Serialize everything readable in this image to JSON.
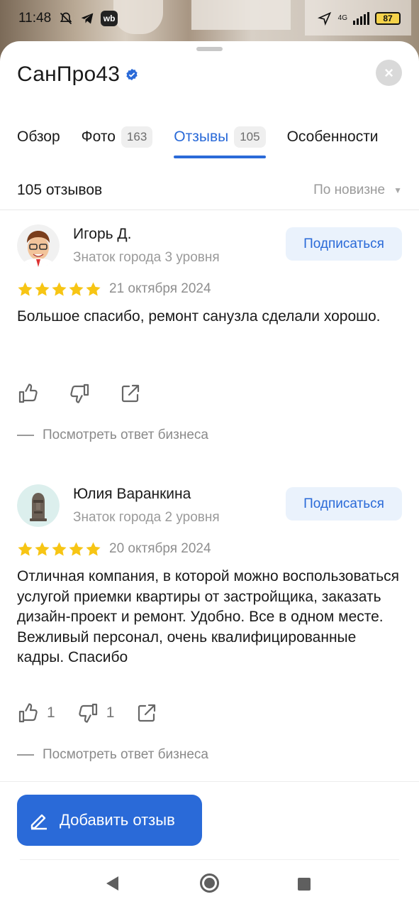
{
  "status_bar": {
    "time": "11:48",
    "net_type": "4G",
    "battery": "87",
    "app_badge": "wb"
  },
  "header": {
    "title": "СанПро43",
    "close_symbol": "×"
  },
  "tabs": [
    {
      "label": "Обзор",
      "count": ""
    },
    {
      "label": "Фото",
      "count": "163"
    },
    {
      "label": "Отзывы",
      "count": "105",
      "active": true
    },
    {
      "label": "Особенности",
      "count": ""
    }
  ],
  "reviews_header": {
    "count_label": "105 отзывов",
    "sort_label": "По новизне"
  },
  "reviews": [
    {
      "author": "Игорь Д.",
      "level": "Знаток города 3 уровня",
      "subscribe_label": "Подписаться",
      "rating": 5,
      "date": "21 октября 2024",
      "text": "Большое спасибо, ремонт санузла сделали хорошо.",
      "likes": "",
      "dislikes": "",
      "reply_label": "Посмотреть ответ бизнеса"
    },
    {
      "author": "Юлия Варанкина",
      "level": "Знаток города 2 уровня",
      "subscribe_label": "Подписаться",
      "rating": 5,
      "date": "20 октября 2024",
      "text": "Отличная компания, в которой можно воспользоваться услугой приемки квартиры от застройщика, заказать дизайн-проект и ремонт. Удобно. Все в одном месте. Вежливый персонал, очень квалифицированные кадры. Спасибо",
      "likes": "1",
      "dislikes": "1",
      "reply_label": "Посмотреть ответ бизнеса"
    }
  ],
  "add_review": {
    "label": "Добавить отзыв"
  },
  "colors": {
    "accent": "#2a6ad8",
    "star": "#f7c514",
    "muted": "#9a9a9a"
  },
  "icons": [
    "back-icon",
    "home-icon",
    "recent-apps-icon",
    "verified-icon",
    "close-icon",
    "like-icon",
    "dislike-icon",
    "share-icon",
    "pencil-icon"
  ]
}
